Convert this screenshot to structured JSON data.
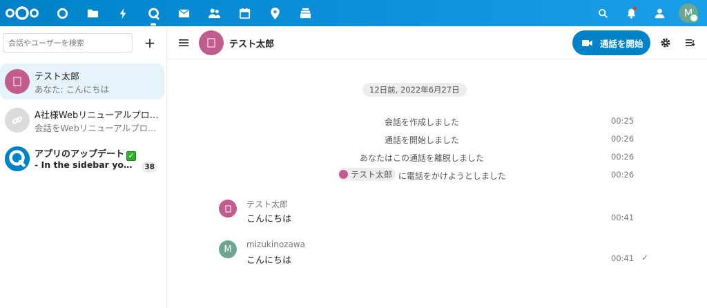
{
  "colors": {
    "brand": "#0082c9",
    "avatar_taro": "#c15d8e",
    "avatar_user": "#6ea68f",
    "avatar_link": "#dbdbdb",
    "status_online": "#49b382"
  },
  "topbar": {
    "apps": [
      "dashboard-icon",
      "files-icon",
      "activity-icon",
      "talk-icon",
      "mail-icon",
      "contacts-icon",
      "calendar-icon",
      "maps-icon",
      "deck-icon"
    ],
    "active_app": "talk-icon",
    "user_initial": "M"
  },
  "sidebar": {
    "search_placeholder": "会話やユーザーを検索",
    "add_label": "+",
    "conversations": [
      {
        "title": "テスト太郎",
        "subtitle": "あなた: こんにちは",
        "icon": "",
        "active": true
      },
      {
        "title": "A社様Webリニューアルプロジ...",
        "subtitle": "会話をWebリニューアルプロ...",
        "icon": "link-icon",
        "active": false
      },
      {
        "title": "アプリのアップデート",
        "subtitle": "- In the sidebar you can ...",
        "icon": "talk-icon",
        "badge": "38",
        "emoji_check": "✓",
        "active": false
      }
    ]
  },
  "header": {
    "menu_icon": "menu-icon",
    "title": "テスト太郎",
    "call_button": "通話を開始",
    "settings_icon": "gear-icon",
    "sidebar_icon": "sidebar-toggle-icon"
  },
  "chat": {
    "date": "12日前, 2022年6月27日",
    "system_messages": [
      {
        "text": "会話を作成しました",
        "time": "00:25"
      },
      {
        "text": "通話を開始しました",
        "time": "00:26"
      },
      {
        "text": "あなたはこの通話を離脱しました",
        "time": "00:26"
      },
      {
        "mention": "テスト太郎",
        "text": " に電話をかけようとしました",
        "time": "00:26"
      }
    ],
    "messages": [
      {
        "author": "テスト太郎",
        "text": "こんにちは",
        "time": "00:41",
        "avatar": ""
      },
      {
        "author": "mizukinozawa",
        "text": "こんにちは",
        "time": "00:41",
        "avatar": "M",
        "status": "✓"
      }
    ]
  }
}
